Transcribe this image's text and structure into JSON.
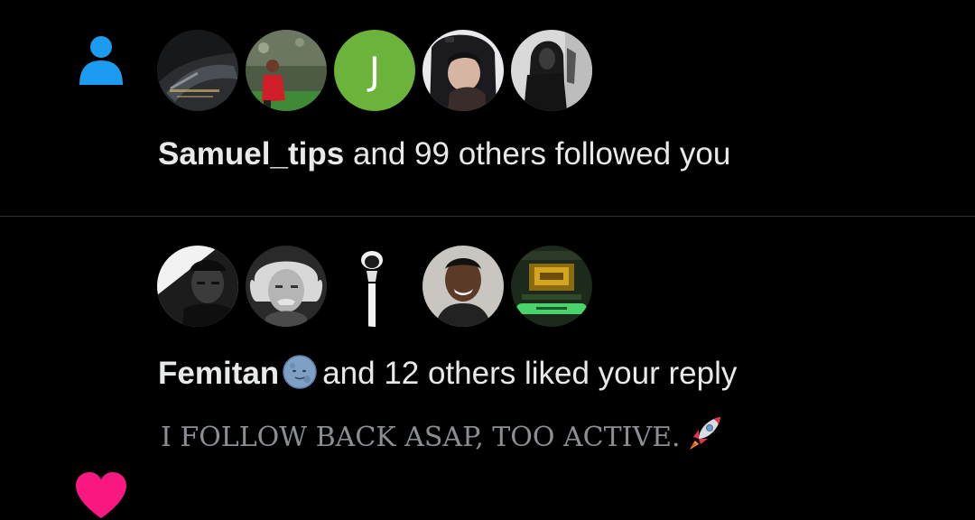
{
  "notifications": [
    {
      "type_icon": "person-icon",
      "avatars": [
        {
          "name": "avatar-dark-photo",
          "letter": ""
        },
        {
          "name": "avatar-football-player",
          "letter": ""
        },
        {
          "name": "avatar-letter-j",
          "letter": "J"
        },
        {
          "name": "avatar-girl-photo",
          "letter": ""
        },
        {
          "name": "avatar-hooded-figure",
          "letter": ""
        }
      ],
      "actor": "Samuel_tips",
      "action_text": "and 99 others followed you"
    },
    {
      "type_icon": "heart-icon",
      "avatars": [
        {
          "name": "avatar-man-portrait",
          "letter": ""
        },
        {
          "name": "avatar-einstein",
          "letter": ""
        },
        {
          "name": "avatar-silhouette",
          "letter": ""
        },
        {
          "name": "avatar-smiling-man",
          "letter": ""
        },
        {
          "name": "avatar-game-screen",
          "letter": ""
        }
      ],
      "actor": "Femitan",
      "actor_emoji": "moon-face-emoji",
      "action_text": "and 12 others liked your reply",
      "reply_preview": "I FOLLOW BACK ASAP, TOO ACTIVE.",
      "reply_emoji": "rocket-emoji"
    }
  ],
  "colors": {
    "background": "#000000",
    "text": "#e7e9ea",
    "secondary_text": "#8b8f93",
    "follow_icon": "#1d9bf0",
    "heart_icon": "#f91880",
    "avatar_j": "#6bb33a",
    "divider": "#2f3336"
  }
}
